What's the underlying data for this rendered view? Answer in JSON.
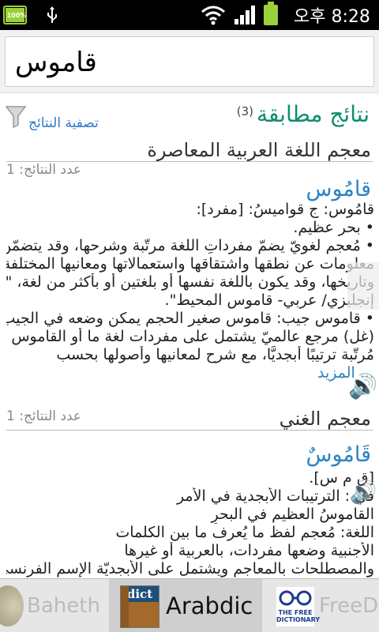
{
  "status_bar": {
    "battery_percent_text": "100%",
    "clock": "오후 8:28"
  },
  "search": {
    "value": "قاموس"
  },
  "results_header": {
    "title": "نتائج مطابقة",
    "count": "(3)",
    "filter_label": "تصفية النتائج"
  },
  "sections": [
    {
      "title": "معجم اللغة العربية المعاصرة",
      "count_label": "عدد النتائج: 1",
      "entry": {
        "word": "قامُوس",
        "lines": [
          "قامُوس: ج قواميسُ: [مفرد]:",
          "• بحر عظيم.",
          "• مُعجم لغويّ يضمّ مفرداتِ اللغة مرتّبة وشرحها، وقد يتضمّن",
          "معلومات عن نطقها واشتقاقها واستعمالاتها ومعانيها المختلفة",
          "وتاريخها، وقد يكون باللغة نفسها أو بلغتين أو بأكثر من لغة، \"قاموس",
          "إنجليزي/ عربي- قاموس المحيط\".",
          "• قاموس جيب: قاموس صغير الحجم يمكن وضعه في الجيب.",
          "(غل) مرجع عالميّ يشتمل على مفردات لغة ما أو القاموس",
          "مُرتّبة ترتيبًا أبجديًّا، مع شرح لمعانيها وأصولها بحسب"
        ],
        "more": "... المزيد"
      }
    },
    {
      "title": "معجم الغني",
      "count_label": "عدد النتائج: 1",
      "entry": {
        "word": "قَامُوسٌ",
        "lines": [
          "[ق م س].",
          "في : الترتيبات الأبجدية في الأمر",
          "القاموسُ العظيم في البحرِ",
          "اللغة: مُعجم لفظ ما يُعرف ما بين الكلمات",
          "الأجنبية وضعها مفردات، بالعربية أو غيرها",
          "والمصطلحات بالمعاجم ويشتمل على الأبجديّة الإسم الفرنسي"
        ]
      }
    }
  ],
  "tabs": [
    {
      "label": "Baheth"
    },
    {
      "label": "Arabdic",
      "icon_text": "dict",
      "active": true
    },
    {
      "label": "FreeDi",
      "icon_text": "THE FREE DICTIONARY"
    }
  ]
}
